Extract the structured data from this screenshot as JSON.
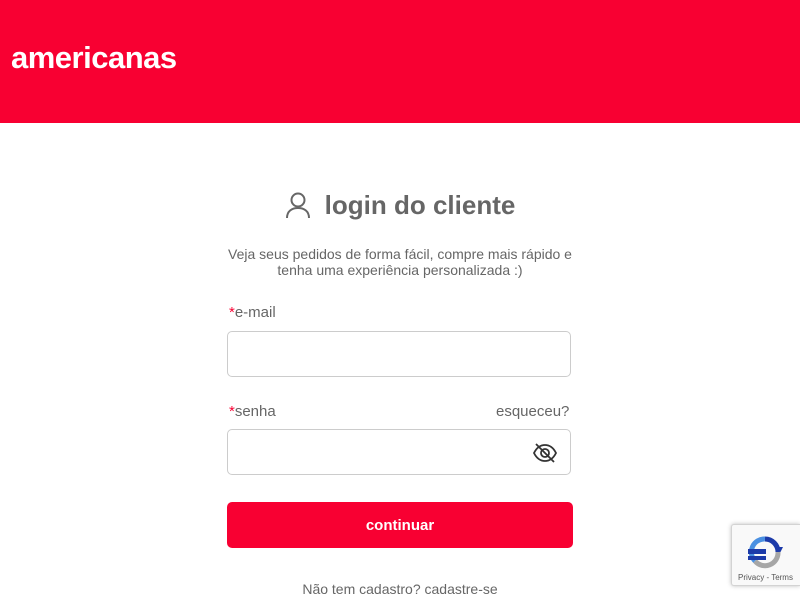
{
  "header": {
    "logo_text": "americanas",
    "background_color": "#f80032"
  },
  "login": {
    "icon": "user-icon",
    "title": "login do cliente",
    "subtitle": "Veja seus pedidos de forma fácil, compre mais rápido e tenha uma experiência personalizada :)",
    "email": {
      "required_mark": "*",
      "label": "e-mail",
      "value": "",
      "placeholder": ""
    },
    "password": {
      "required_mark": "*",
      "label": "senha",
      "value": "",
      "placeholder": "",
      "toggle_icon": "eye-off-icon"
    },
    "forgot_link": "esqueceu?",
    "continue_button": "continuar",
    "signup": {
      "prompt": "Não tem cadastro?",
      "link": "cadastre-se"
    }
  },
  "recaptcha": {
    "icon": "recaptcha-icon",
    "terms": "Privacy - Terms"
  }
}
